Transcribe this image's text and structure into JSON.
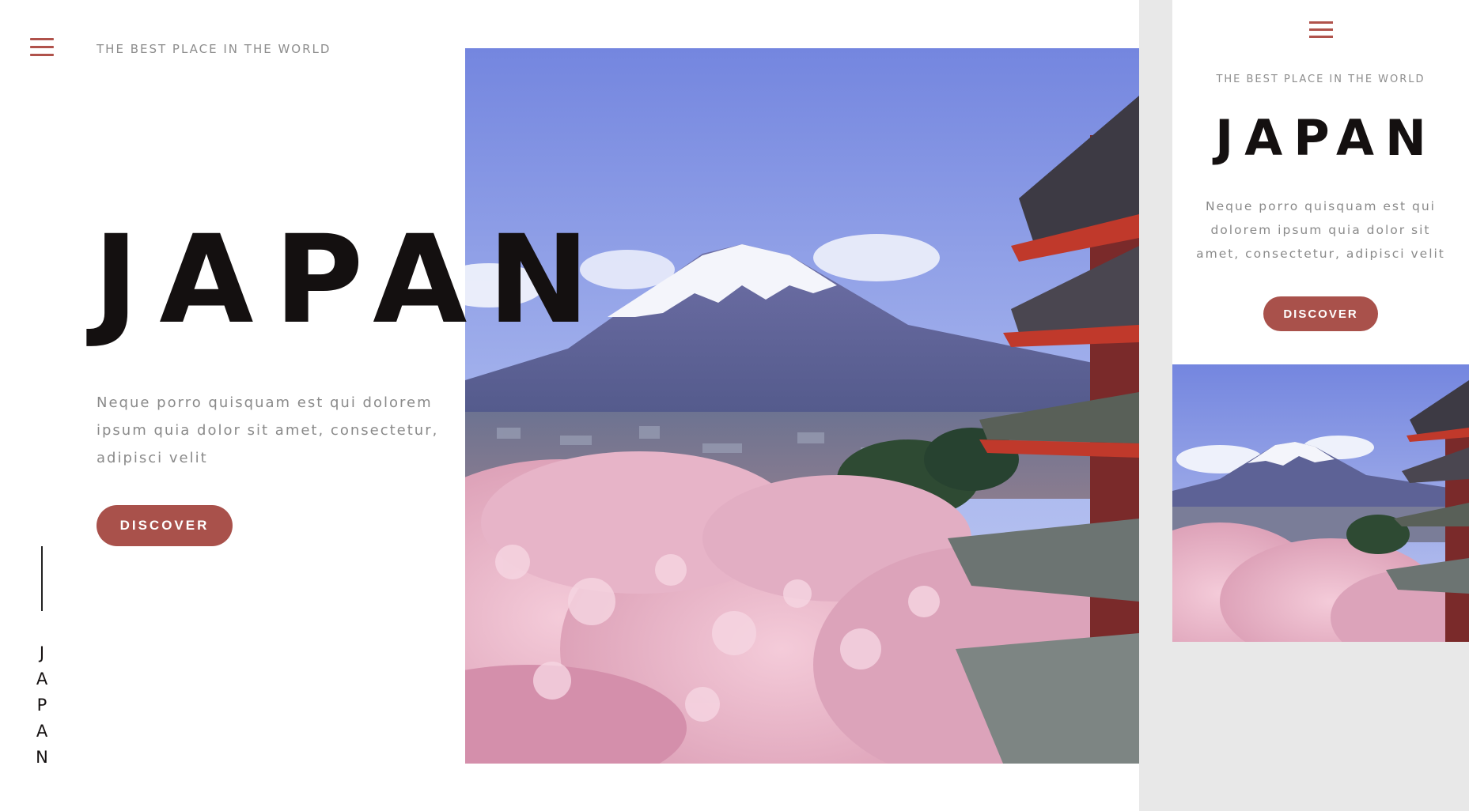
{
  "desktop": {
    "tagline": "THE BEST PLACE IN THE WORLD",
    "title": "JAPAN",
    "description": "Neque porro quisquam est qui dolorem ipsum quia dolor sit amet, consectetur, adipisci velit",
    "discover_label": "DISCOVER",
    "vertical_letters": [
      "J",
      "A",
      "P",
      "A",
      "N"
    ],
    "menu_icon": "hamburger-menu-icon",
    "photo": "mount-fuji-cherry-blossom-pagoda-photo"
  },
  "mobile": {
    "tagline": "THE BEST PLACE IN THE WORLD",
    "title": "JAPAN",
    "description": "Neque porro quisquam est qui dolorem ipsum quia dolor sit amet, consectetur, adipisci velit",
    "discover_label": "DISCOVER",
    "menu_icon": "hamburger-menu-icon",
    "photo": "mount-fuji-cherry-blossom-pagoda-photo"
  },
  "colors": {
    "accent": "#a9514b",
    "title": "#141010",
    "muted_text": "#8a8a8a",
    "side_background": "#e8e8e8"
  }
}
